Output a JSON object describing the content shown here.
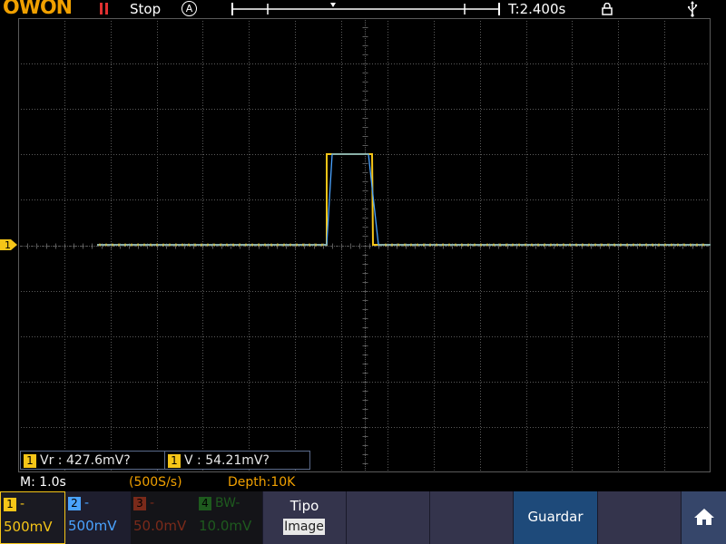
{
  "topbar": {
    "logo": "OWON",
    "status": "Stop",
    "acq_mode_glyph": "A",
    "time_label": "T:2.400s",
    "icons": [
      "pause-icon",
      "auto-trigger-icon",
      "lock-icon",
      "usb-icon"
    ]
  },
  "channels": [
    {
      "num": "1",
      "label": "-",
      "scale": "500mV",
      "color": "#f5c518",
      "active": true
    },
    {
      "num": "2",
      "label": "-",
      "scale": "500mV",
      "color": "#4aa3ff",
      "active": true
    },
    {
      "num": "3",
      "label": "-",
      "scale": "50.0mV",
      "color": "#7a2a1a",
      "active": false
    },
    {
      "num": "4",
      "label": "BW-",
      "scale": "10.0mV",
      "color": "#1e5a1e",
      "active": false
    }
  ],
  "ch1_marker": "1",
  "measurements": [
    {
      "badge": "1",
      "text": "Vr : 427.6mV?"
    },
    {
      "badge": "1",
      "text": "V : 54.21mV?"
    }
  ],
  "timebase": {
    "main": "M: 1.0s",
    "rate": "(500S/s)",
    "depth": "Depth:10K"
  },
  "menu": {
    "type_title": "Tipo",
    "type_value": "Image",
    "save_label": "Guardar"
  },
  "colors": {
    "ch1": "#f5c518",
    "ch2": "#4aa3ff",
    "logo": "#f0a000",
    "grid": "#5a5a5a",
    "menu_bg": "#2a2a3e",
    "save_bg": "#1e4a7a"
  }
}
